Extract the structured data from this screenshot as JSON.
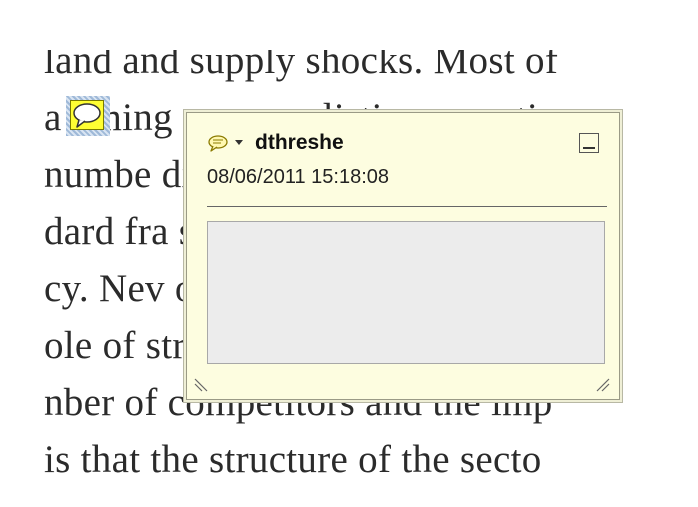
{
  "document": {
    "lines": [
      "land and supply shocks. Most of",
      "a  uming  more  realistic  competi",
      "numbe                            diff",
      "dard fra                         sis",
      "cy. Nev                          o  c",
      "ole of str                       two",
      "nber of competitors and the imp",
      " is that the structure of the secto"
    ]
  },
  "popup": {
    "author": "dthreshe",
    "date": "08/06/2011 15:18:08",
    "text": "",
    "colors": {
      "background": "#fdfde0",
      "accent": "#ffff33"
    }
  }
}
